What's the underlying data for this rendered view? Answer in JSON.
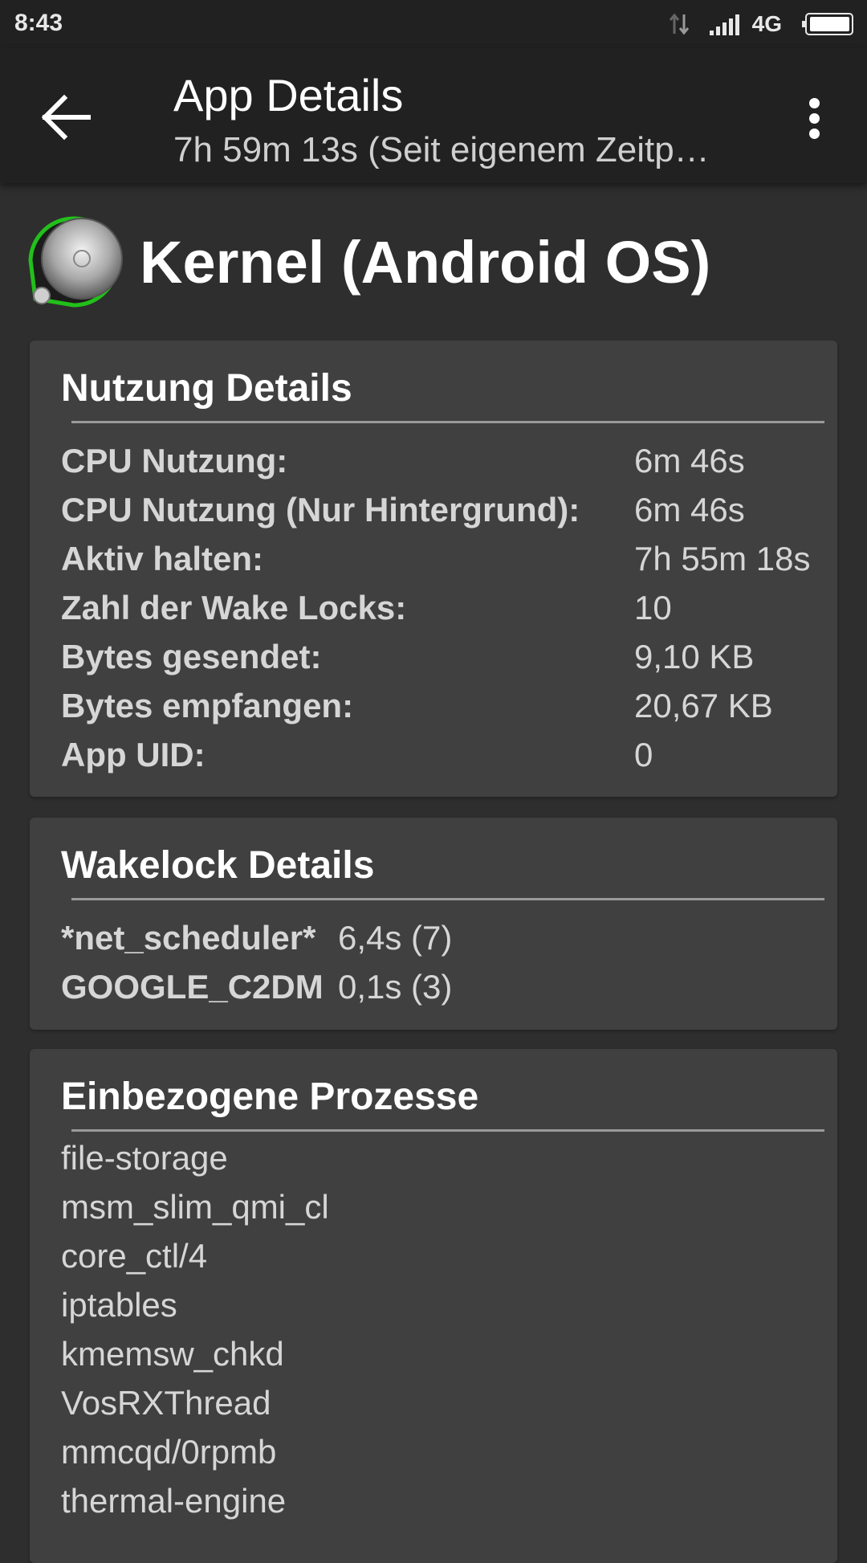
{
  "status_bar": {
    "time": "8:43",
    "network": "4G",
    "icons": [
      "data-arrows-icon",
      "signal-icon",
      "battery-icon"
    ]
  },
  "app_bar": {
    "title": "App Details",
    "subtitle": "7h 59m 13s (Seit eigenem Zeitp…",
    "back_icon": "arrow-back-icon",
    "menu_icon": "more-vert-icon"
  },
  "app": {
    "name": "Kernel (Android OS)",
    "icon": "android-os-icon"
  },
  "usage": {
    "title": "Nutzung Details",
    "rows": [
      {
        "label": "CPU Nutzung:",
        "value": "6m 46s"
      },
      {
        "label": "CPU Nutzung (Nur Hintergrund):",
        "value": "6m 46s"
      },
      {
        "label": "Aktiv halten:",
        "value": "7h 55m 18s"
      },
      {
        "label": "Zahl der Wake Locks:",
        "value": "10"
      },
      {
        "label": "Bytes gesendet:",
        "value": "9,10 KB"
      },
      {
        "label": "Bytes empfangen:",
        "value": "20,67 KB"
      },
      {
        "label": "App UID:",
        "value": "0"
      }
    ]
  },
  "wakelocks": {
    "title": "Wakelock Details",
    "rows": [
      {
        "label": "*net_scheduler*",
        "value": "6,4s (7)"
      },
      {
        "label": "GOOGLE_C2DM",
        "value": "0,1s (3)"
      }
    ]
  },
  "processes": {
    "title": "Einbezogene Prozesse",
    "items": [
      "file-storage",
      "msm_slim_qmi_cl",
      "core_ctl/4",
      "iptables",
      "kmemsw_chkd",
      "VosRXThread",
      "mmcqd/0rpmb",
      "thermal-engine"
    ]
  },
  "colors": {
    "background": "#2e2e2e",
    "app_bar": "#212121",
    "card": "#404040",
    "icon_ring": "#22c01a"
  }
}
